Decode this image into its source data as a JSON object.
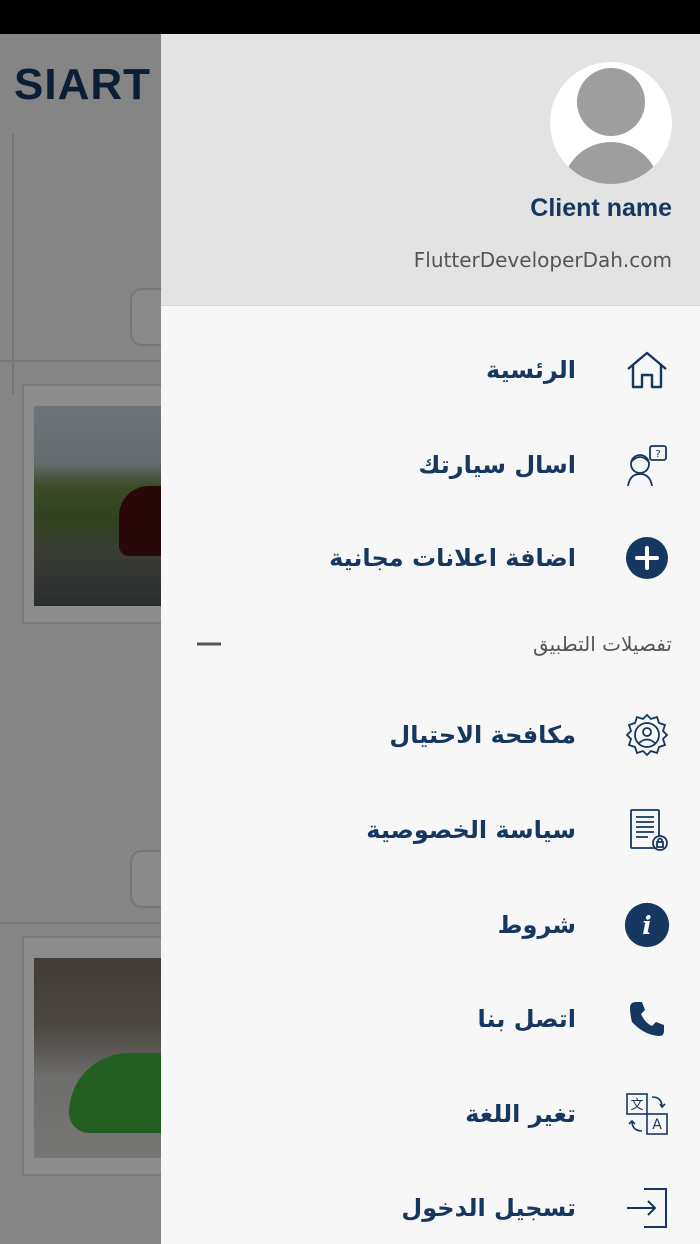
{
  "background": {
    "logo_text": "SIART"
  },
  "drawer": {
    "client_name": "Client name",
    "client_email": "FlutterDeveloperDah.com",
    "items": [
      {
        "label": "الرئسية",
        "icon": "home-icon"
      },
      {
        "label": "اسال سيارتك",
        "icon": "question-person-icon"
      },
      {
        "label": "اضافة اعلانات مجانية",
        "icon": "add-circle-icon"
      }
    ],
    "section": {
      "label": "تفصيلات التطبيق",
      "toggle": "collapse-icon"
    },
    "section_items": [
      {
        "label": "مكافحة الاحتيال",
        "icon": "anti-fraud-gear-icon"
      },
      {
        "label": "سياسة الخصوصية",
        "icon": "privacy-document-icon"
      },
      {
        "label": "شروط",
        "icon": "info-icon"
      },
      {
        "label": "اتصل بنا",
        "icon": "phone-icon"
      },
      {
        "label": "تغير اللغة",
        "icon": "translate-icon"
      },
      {
        "label": "تسجيل الدخول",
        "icon": "login-icon"
      }
    ]
  },
  "colors": {
    "brand": "#16375f",
    "drawer_bg": "#f7f7f7",
    "header_bg": "#e3e3e3"
  }
}
